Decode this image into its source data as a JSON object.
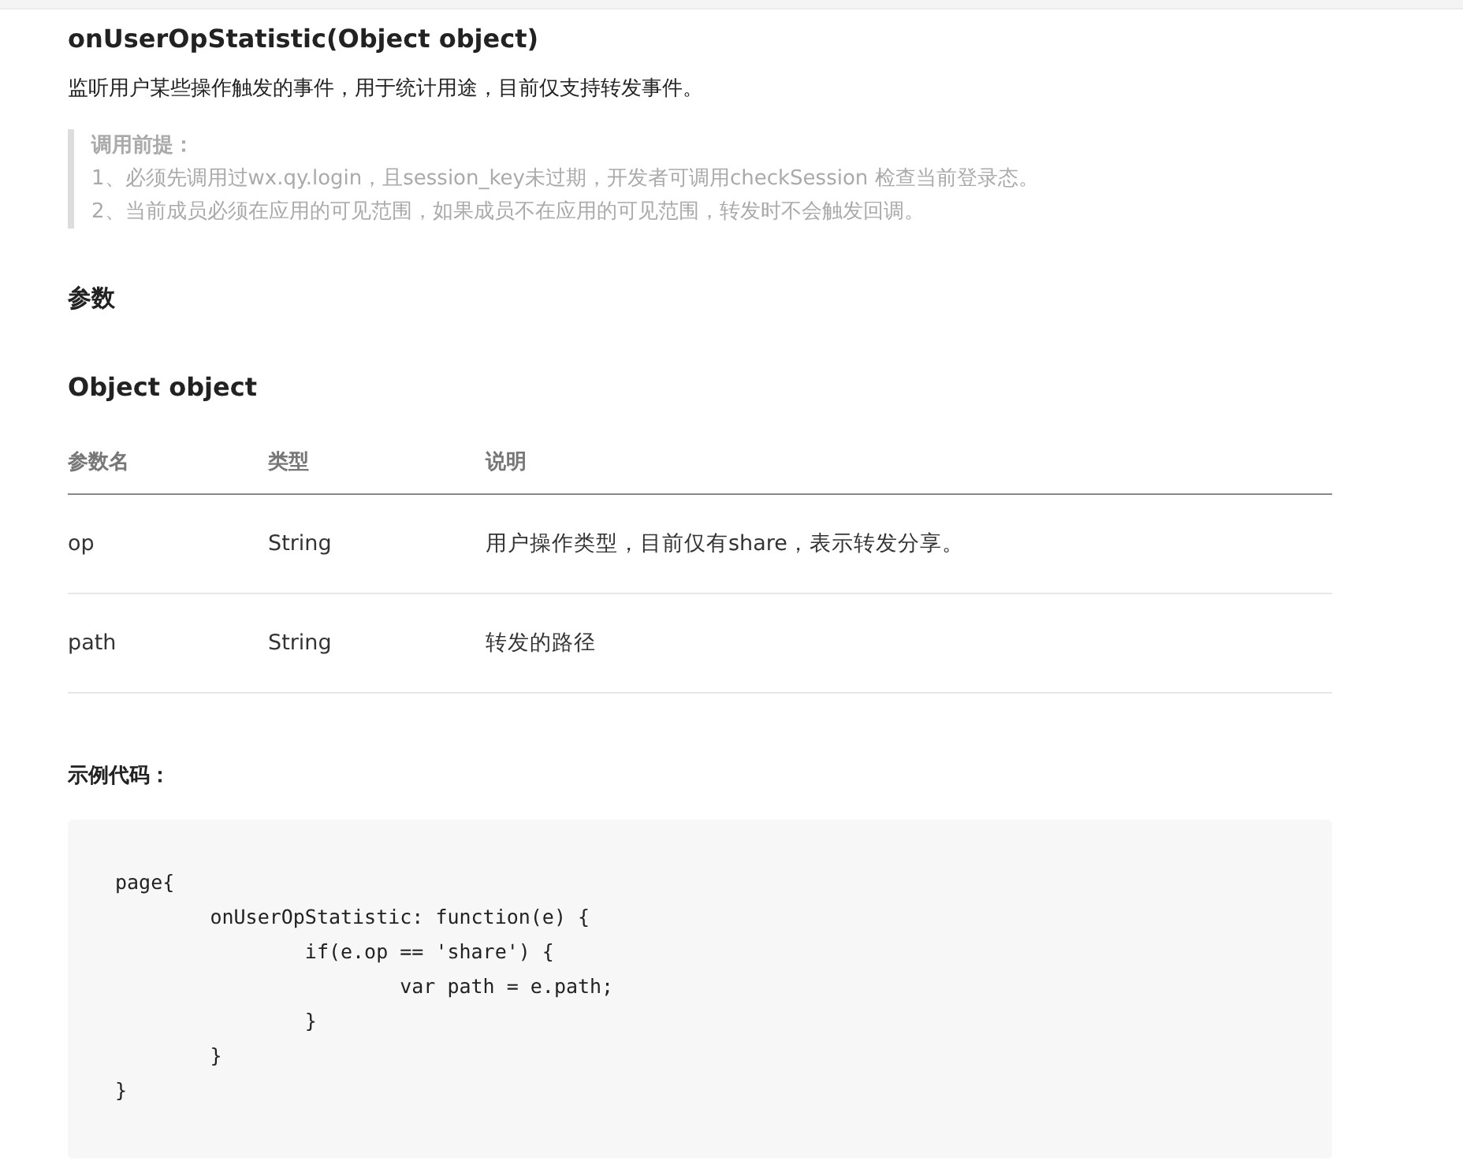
{
  "title": "onUserOpStatistic(Object object)",
  "description": "监听用户某些操作触发的事件，用于统计用途，目前仅支持转发事件。",
  "note": {
    "heading": "调用前提：",
    "lines": [
      "1、必须先调用过wx.qy.login，且session_key未过期，开发者可调用checkSession 检查当前登录态。",
      "2、当前成员必须在应用的可见范围，如果成员不在应用的可见范围，转发时不会触发回调。"
    ]
  },
  "params_heading": "参数",
  "object_heading": "Object object",
  "table": {
    "columns": [
      "参数名",
      "类型",
      "说明"
    ],
    "rows": [
      [
        "op",
        "String",
        "用户操作类型，目前仅有share，表示转发分享。"
      ],
      [
        "path",
        "String",
        "转发的路径"
      ]
    ]
  },
  "example_heading": "示例代码：",
  "code": "page{\n\tonUserOpStatistic: function(e) {\n\t\tif(e.op == 'share') {\n\t\t\tvar path = e.path;\n\t\t}\n\t}\n}"
}
